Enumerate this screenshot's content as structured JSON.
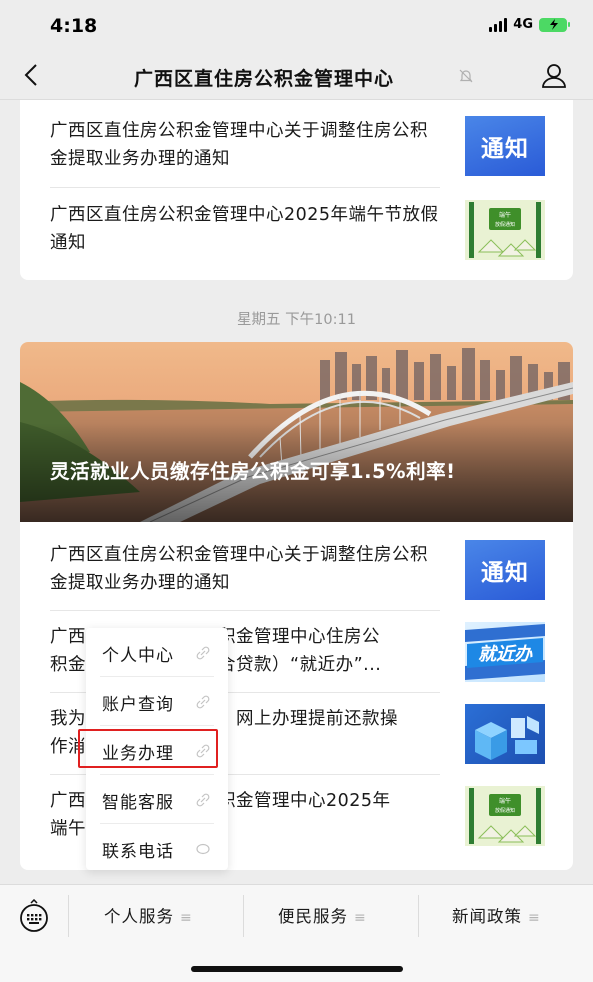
{
  "status_bar": {
    "time": "4:18",
    "network": "4G"
  },
  "nav": {
    "title": "广西区直住房公积金管理中心"
  },
  "card1": {
    "items": [
      {
        "title": "广西区直住房公积金管理中心关于调整住房公积金提取业务办理的通知",
        "thumb_text": "通知"
      },
      {
        "title": "广西区直住房公积金管理中心2025年端午节放假通知",
        "thumb_text": "端午\n放假通知"
      }
    ]
  },
  "time_label": "星期五 下午10:11",
  "card2": {
    "hero_title": "灵活就业人员缴存住房公积金可享1.5%利率!",
    "items": [
      {
        "title": "广西区直住房公积金管理中心关于调整住房公积金提取业务办理的通知",
        "thumb_text": "通知"
      },
      {
        "title_line1_left": "广西",
        "title_line1_right": "积金管理中心住房公",
        "title_line2_left": "积金",
        "title_line2_right": "合贷款）“就近办”...",
        "thumb_text": "就近办"
      },
      {
        "title_line1_left": "我为",
        "title_line1_right": "网上办理提前还款操",
        "title_line2_left": "作消",
        "title_line2_right": ""
      },
      {
        "title_line1_left": "广西",
        "title_line1_right": "积金管理中心2025年",
        "title_line2_left": "端午",
        "title_line2_right": "",
        "thumb_text": "端午\n放假通知"
      }
    ]
  },
  "popup_menu": {
    "items": [
      "个人中心",
      "账户查询",
      "业务办理",
      "智能客服",
      "联系电话"
    ],
    "highlighted": "业务办理"
  },
  "bottom_menu": {
    "tabs": [
      "个人服务",
      "便民服务",
      "新闻政策"
    ]
  },
  "colors": {
    "highlight": "#e02020",
    "notice_blue": "#2a5bd7",
    "battery": "#4cd964"
  }
}
